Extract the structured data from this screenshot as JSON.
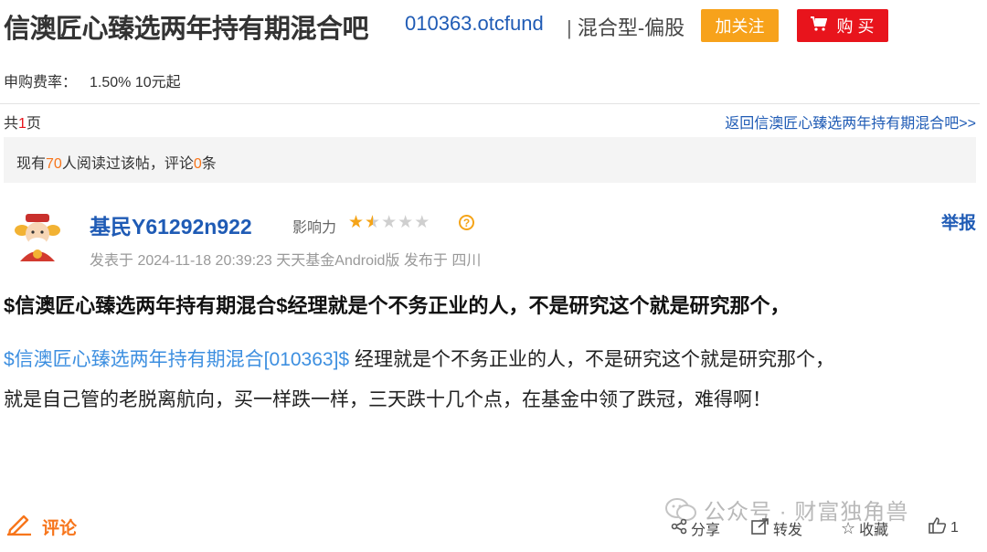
{
  "header": {
    "title": "信澳匠心臻选两年持有期混合吧",
    "code": "010363.otcfund",
    "separator": "|",
    "fund_type": "混合型-偏股",
    "follow_label": "加关注",
    "buy_label": "购 买"
  },
  "fee": {
    "label": "申购费率：",
    "value": "1.50% 10元起"
  },
  "pagination": {
    "prefix": "共",
    "count": "1",
    "suffix": "页",
    "back_link": "返回信澳匠心臻选两年持有期混合吧>>"
  },
  "stats": {
    "prefix": "现有",
    "readers": "70",
    "middle": "人阅读过该帖，评论",
    "comments": "0",
    "suffix": "条"
  },
  "post": {
    "author": "基民Y61292n922",
    "influence_label": "影响力",
    "influence_stars": 1.5,
    "influence_max": 5,
    "report_label": "举报",
    "meta": "发表于 2024-11-18 20:39:23 天天基金Android版 发布于 四川",
    "title": "$信澳匠心臻选两年持有期混合$经理就是个不务正业的人，不是研究这个就是研究那个，",
    "fund_link": "$信澳匠心臻选两年持有期混合[010363]$",
    "body_line1": " 经理就是个不务正业的人，不是研究这个就是研究那个，",
    "body_line2": "就是自己管的老脱离航向，买一样跌一样，三天跌十几个点，在基金中领了跌冠，难得啊！"
  },
  "footer": {
    "comment_label": "评论",
    "watermark": "公众号 · 财富独角兽",
    "share_label": "分享",
    "forward_label": "转发",
    "collect_label": "收藏",
    "like_count": "1"
  },
  "colors": {
    "link_blue": "#1f5bb5",
    "follow_orange": "#f7a21b",
    "buy_red": "#e8141c",
    "highlight_orange": "#f7751b",
    "star": "#f5a418"
  }
}
